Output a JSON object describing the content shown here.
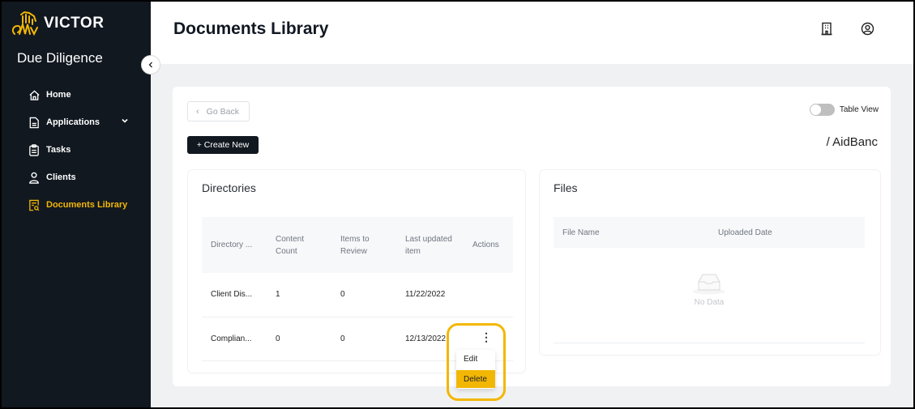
{
  "sidebar": {
    "brand": "VICTOR",
    "app_name": "Due Diligence",
    "items": [
      {
        "label": "Home",
        "icon": "home-icon",
        "active": false
      },
      {
        "label": "Applications",
        "icon": "document-icon",
        "active": false,
        "expandable": true
      },
      {
        "label": "Tasks",
        "icon": "clipboard-icon",
        "active": false
      },
      {
        "label": "Clients",
        "icon": "user-icon",
        "active": false
      },
      {
        "label": "Documents Library",
        "icon": "document-search-icon",
        "active": true
      }
    ]
  },
  "header": {
    "title": "Documents Library",
    "icons": [
      "building-icon",
      "user-circle-icon"
    ]
  },
  "toolbar": {
    "go_back_label": "Go Back",
    "create_new_label": "+ Create New",
    "table_view_label": "Table View",
    "table_view_on": false,
    "path": "/ AidBanc"
  },
  "directories": {
    "title": "Directories",
    "columns": [
      "Directory ...",
      "Content Count",
      "Items to Review",
      "Last updated item",
      "Actions"
    ],
    "rows": [
      {
        "name": "Client Dis...",
        "content_count": "1",
        "items_to_review": "0",
        "last_updated": "11/22/2022"
      },
      {
        "name": "Complian...",
        "content_count": "0",
        "items_to_review": "0",
        "last_updated": "12/13/2022"
      }
    ]
  },
  "files": {
    "title": "Files",
    "columns": [
      "File Name",
      "Uploaded Date"
    ],
    "empty_text": "No Data"
  },
  "action_menu": {
    "items": [
      "Edit",
      "Delete"
    ],
    "highlighted": "Delete"
  },
  "colors": {
    "accent": "#f2b705",
    "sidebar_bg": "#121820"
  }
}
